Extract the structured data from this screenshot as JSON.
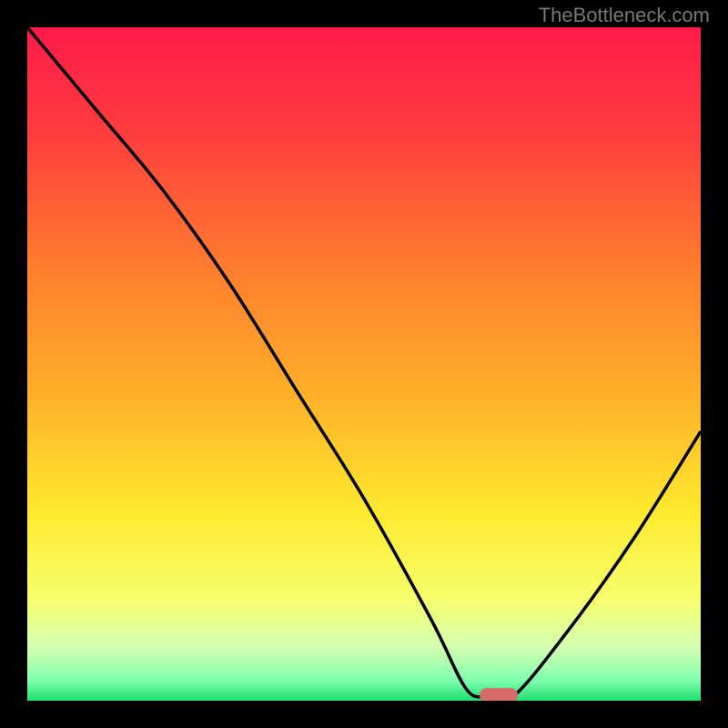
{
  "watermark": "TheBottleneck.com",
  "chart_data": {
    "type": "line",
    "title": "",
    "xlabel": "",
    "ylabel": "",
    "xlim": [
      0,
      100
    ],
    "ylim": [
      0,
      100
    ],
    "series": [
      {
        "name": "bottleneck-curve",
        "x": [
          0,
          10,
          20,
          30,
          40,
          50,
          60,
          65,
          68,
          72,
          80,
          90,
          100
        ],
        "values": [
          100,
          88,
          76,
          62,
          46,
          30,
          12,
          2,
          0.5,
          0.5,
          10,
          24,
          40
        ]
      }
    ],
    "optimal_marker": {
      "x": 70,
      "y": 0.8
    },
    "gradient_stops": [
      {
        "offset": 0.0,
        "color": "#ff1a4a"
      },
      {
        "offset": 0.15,
        "color": "#ff3b3f"
      },
      {
        "offset": 0.35,
        "color": "#ff7a2e"
      },
      {
        "offset": 0.55,
        "color": "#ffb129"
      },
      {
        "offset": 0.72,
        "color": "#ffe92e"
      },
      {
        "offset": 0.85,
        "color": "#f6ff6e"
      },
      {
        "offset": 0.92,
        "color": "#d4ffb0"
      },
      {
        "offset": 0.97,
        "color": "#7fffb0"
      },
      {
        "offset": 1.0,
        "color": "#1fde6e"
      }
    ],
    "marker_color": "#d86a6a"
  }
}
